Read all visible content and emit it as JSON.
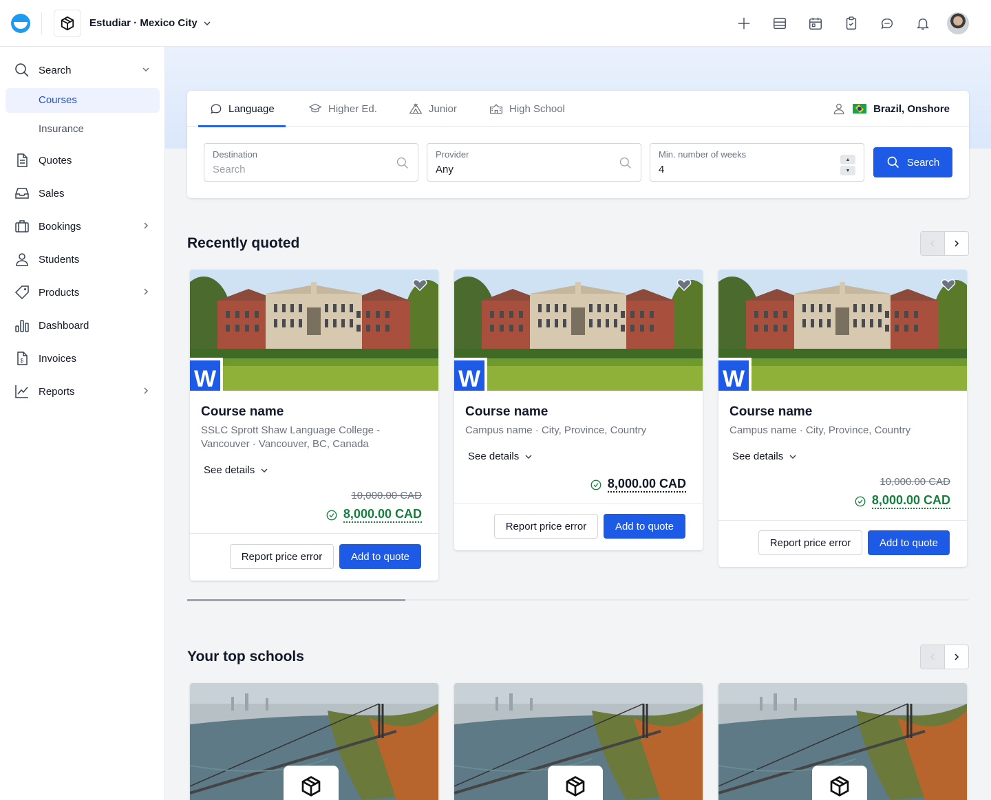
{
  "topbar": {
    "agency_name": "Estudiar · Mexico City",
    "icons": [
      "plus-icon",
      "inbox-icon",
      "calendar-icon",
      "clipboard-check-icon",
      "chat-icon",
      "bell-icon"
    ]
  },
  "sidebar": {
    "search": "Search",
    "courses": "Courses",
    "insurance": "Insurance",
    "quotes": "Quotes",
    "sales": "Sales",
    "bookings": "Bookings",
    "students": "Students",
    "products": "Products",
    "dashboard": "Dashboard",
    "invoices": "Invoices",
    "reports": "Reports"
  },
  "tabs": [
    "Language",
    "Higher Ed.",
    "Junior",
    "High School"
  ],
  "market": "Brazil, Onshore",
  "fields": {
    "destination": {
      "label": "Destination",
      "placeholder": "Search"
    },
    "provider": {
      "label": "Provider",
      "value": "Any"
    },
    "weeks": {
      "label": "Min. number of weeks",
      "value": "4"
    }
  },
  "search_button": "Search",
  "sections": {
    "recent": "Recently quoted",
    "top_schools": "Your top schools"
  },
  "cards": [
    {
      "title": "Course name",
      "subtitle": "SSLC Sprott Shaw Language College - Vancouver · Vancouver, BC, Canada",
      "see_details": "See details",
      "old_price": "10,000.00 CAD",
      "price": "8,000.00 CAD",
      "report": "Report price error",
      "add": "Add to quote",
      "badge": "W"
    },
    {
      "title": "Course name",
      "subtitle": "Campus name · City, Province, Country",
      "see_details": "See details",
      "price": "8,000.00 CAD",
      "report": "Report price error",
      "add": "Add to quote",
      "badge": "W"
    },
    {
      "title": "Course name",
      "subtitle": "Campus name · City, Province, Country",
      "see_details": "See details",
      "old_price": "10,000.00 CAD",
      "price": "8,000.00 CAD",
      "report": "Report price error",
      "add": "Add to quote",
      "badge": "W"
    }
  ],
  "colors": {
    "primary": "#1d5be6",
    "success": "#15803d",
    "brand": "#1d9bf0"
  }
}
